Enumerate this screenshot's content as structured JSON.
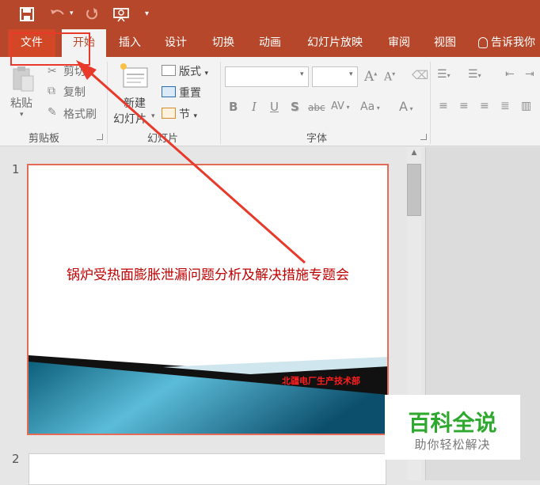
{
  "quick_access": {
    "save_icon": "save-icon",
    "undo_icon": "undo-icon",
    "redo_icon": "redo-icon",
    "present_icon": "present-from-start-icon",
    "customize_icon": "customize-qat-icon"
  },
  "tabs": {
    "file": "文件",
    "home": "开始",
    "insert": "插入",
    "design": "设计",
    "transitions": "切换",
    "animations": "动画",
    "slideshow": "幻灯片放映",
    "review": "审阅",
    "view": "视图",
    "tell_me": "告诉我你"
  },
  "ribbon": {
    "clipboard": {
      "paste": "粘贴",
      "cut": "剪切",
      "copy": "复制",
      "format_painter": "格式刷",
      "group_label": "剪贴板"
    },
    "slides": {
      "new_slide_line1": "新建",
      "new_slide_line2": "幻灯片",
      "layout": "版式",
      "reset": "重置",
      "section": "节",
      "group_label": "幻灯片"
    },
    "font": {
      "group_label": "字体",
      "bold": "B",
      "italic": "I",
      "underline": "U",
      "shadow": "S",
      "strike": "abc",
      "spacing": "AV",
      "case": "Aa",
      "color": "A",
      "grow": "A",
      "shrink": "A"
    }
  },
  "slides": [
    {
      "number": "1",
      "title": "锅炉受热面膨胀泄漏问题分析及解决措施专题会",
      "footer": "北疆电厂生产技术部"
    },
    {
      "number": "2"
    }
  ],
  "watermark": {
    "title": "百科全说",
    "subtitle": "助你轻松解决"
  },
  "colors": {
    "accent": "#b7472a",
    "highlight": "#e8392b",
    "title_red": "#c00000"
  }
}
